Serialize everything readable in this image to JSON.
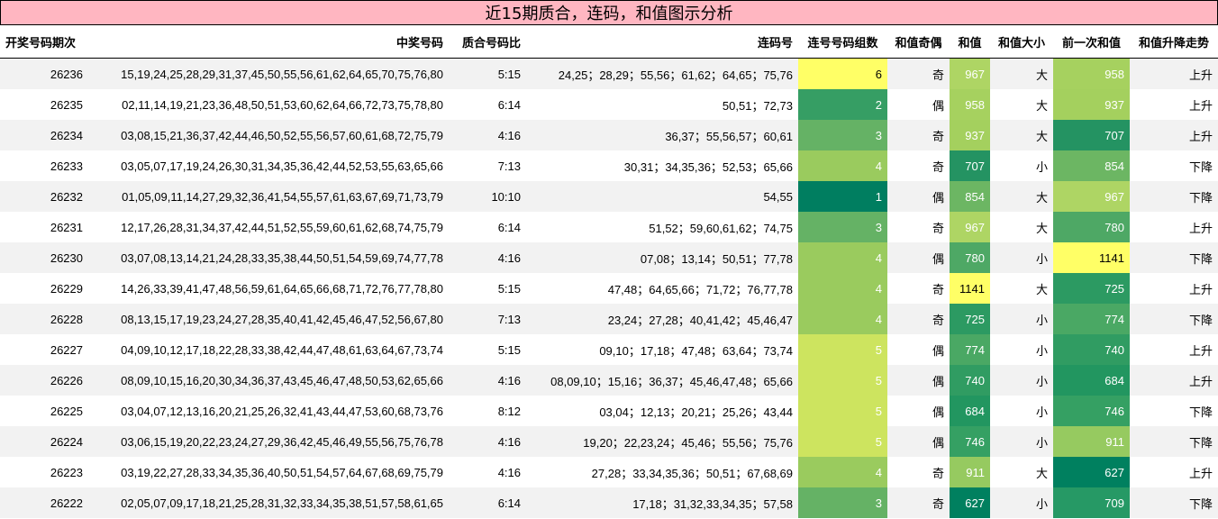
{
  "title": "近15期质合，连码，和值图示分析",
  "headers": [
    "开奖号码期次",
    "中奖号码",
    "质合号码比",
    "连码号",
    "连号号码组数",
    "和值奇偶",
    "和值",
    "和值大小",
    "前一次和值",
    "和值升降走势"
  ],
  "colors": {
    "title_bg": "#ffb6c1",
    "row_odd": "#f2f2f2",
    "row_even": "#ffffff",
    "heat": {
      "1": "#007e60",
      "2": "#369e64",
      "3": "#65b265",
      "4": "#9acb5e",
      "5": "#cde45f",
      "6": "#ffff66",
      "627": "#00805f",
      "684": "#229660",
      "707": "#249362",
      "709": "#269965",
      "725": "#2c9a62",
      "740": "#309c62",
      "746": "#35a063",
      "774": "#4aa864",
      "780": "#4ea865",
      "854": "#6cb663",
      "911": "#96ca60",
      "937": "#a4d05e",
      "958": "#a6d15f",
      "967": "#aed564",
      "1141": "#ffff66"
    }
  },
  "rows": [
    {
      "period": "26236",
      "numbers": "15,19,24,25,28,29,31,37,45,50,55,56,61,62,64,65,70,75,76,80",
      "ratio": "5:15",
      "consec": "24,25；28,29；55,56；61,62；64,65；75,76",
      "groups": "6",
      "parity": "奇",
      "sum": "967",
      "size": "大",
      "prev_sum": "958",
      "trend": "上升"
    },
    {
      "period": "26235",
      "numbers": "02,11,14,19,21,23,36,48,50,51,53,60,62,64,66,72,73,75,78,80",
      "ratio": "6:14",
      "consec": "50,51；72,73",
      "groups": "2",
      "parity": "偶",
      "sum": "958",
      "size": "大",
      "prev_sum": "937",
      "trend": "上升"
    },
    {
      "period": "26234",
      "numbers": "03,08,15,21,36,37,42,44,46,50,52,55,56,57,60,61,68,72,75,79",
      "ratio": "4:16",
      "consec": "36,37；55,56,57；60,61",
      "groups": "3",
      "parity": "奇",
      "sum": "937",
      "size": "大",
      "prev_sum": "707",
      "trend": "上升"
    },
    {
      "period": "26233",
      "numbers": "03,05,07,17,19,24,26,30,31,34,35,36,42,44,52,53,55,63,65,66",
      "ratio": "7:13",
      "consec": "30,31；34,35,36；52,53；65,66",
      "groups": "4",
      "parity": "奇",
      "sum": "707",
      "size": "小",
      "prev_sum": "854",
      "trend": "下降"
    },
    {
      "period": "26232",
      "numbers": "01,05,09,11,14,27,29,32,36,41,54,55,57,61,63,67,69,71,73,79",
      "ratio": "10:10",
      "consec": "54,55",
      "groups": "1",
      "parity": "偶",
      "sum": "854",
      "size": "大",
      "prev_sum": "967",
      "trend": "下降"
    },
    {
      "period": "26231",
      "numbers": "12,17,26,28,31,34,37,42,44,51,52,55,59,60,61,62,68,74,75,79",
      "ratio": "6:14",
      "consec": "51,52；59,60,61,62；74,75",
      "groups": "3",
      "parity": "奇",
      "sum": "967",
      "size": "大",
      "prev_sum": "780",
      "trend": "上升"
    },
    {
      "period": "26230",
      "numbers": "03,07,08,13,14,21,24,28,33,35,38,44,50,51,54,59,69,74,77,78",
      "ratio": "4:16",
      "consec": "07,08；13,14；50,51；77,78",
      "groups": "4",
      "parity": "偶",
      "sum": "780",
      "size": "小",
      "prev_sum": "1141",
      "trend": "下降"
    },
    {
      "period": "26229",
      "numbers": "14,26,33,39,41,47,48,56,59,61,64,65,66,68,71,72,76,77,78,80",
      "ratio": "5:15",
      "consec": "47,48；64,65,66；71,72；76,77,78",
      "groups": "4",
      "parity": "奇",
      "sum": "1141",
      "size": "大",
      "prev_sum": "725",
      "trend": "上升"
    },
    {
      "period": "26228",
      "numbers": "08,13,15,17,19,23,24,27,28,35,40,41,42,45,46,47,52,56,67,80",
      "ratio": "7:13",
      "consec": "23,24；27,28；40,41,42；45,46,47",
      "groups": "4",
      "parity": "奇",
      "sum": "725",
      "size": "小",
      "prev_sum": "774",
      "trend": "下降"
    },
    {
      "period": "26227",
      "numbers": "04,09,10,12,17,18,22,28,33,38,42,44,47,48,61,63,64,67,73,74",
      "ratio": "5:15",
      "consec": "09,10；17,18；47,48；63,64；73,74",
      "groups": "5",
      "parity": "偶",
      "sum": "774",
      "size": "小",
      "prev_sum": "740",
      "trend": "上升"
    },
    {
      "period": "26226",
      "numbers": "08,09,10,15,16,20,30,34,36,37,43,45,46,47,48,50,53,62,65,66",
      "ratio": "4:16",
      "consec": "08,09,10；15,16；36,37；45,46,47,48；65,66",
      "groups": "5",
      "parity": "偶",
      "sum": "740",
      "size": "小",
      "prev_sum": "684",
      "trend": "上升"
    },
    {
      "period": "26225",
      "numbers": "03,04,07,12,13,16,20,21,25,26,32,41,43,44,47,53,60,68,73,76",
      "ratio": "8:12",
      "consec": "03,04；12,13；20,21；25,26；43,44",
      "groups": "5",
      "parity": "偶",
      "sum": "684",
      "size": "小",
      "prev_sum": "746",
      "trend": "下降"
    },
    {
      "period": "26224",
      "numbers": "03,06,15,19,20,22,23,24,27,29,36,42,45,46,49,55,56,75,76,78",
      "ratio": "4:16",
      "consec": "19,20；22,23,24；45,46；55,56；75,76",
      "groups": "5",
      "parity": "偶",
      "sum": "746",
      "size": "小",
      "prev_sum": "911",
      "trend": "下降"
    },
    {
      "period": "26223",
      "numbers": "03,19,22,27,28,33,34,35,36,40,50,51,54,57,64,67,68,69,75,79",
      "ratio": "4:16",
      "consec": "27,28；33,34,35,36；50,51；67,68,69",
      "groups": "4",
      "parity": "奇",
      "sum": "911",
      "size": "大",
      "prev_sum": "627",
      "trend": "上升"
    },
    {
      "period": "26222",
      "numbers": "02,05,07,09,17,18,21,25,28,31,32,33,34,35,38,51,57,58,61,65",
      "ratio": "6:14",
      "consec": "17,18；31,32,33,34,35；57,58",
      "groups": "3",
      "parity": "奇",
      "sum": "627",
      "size": "小",
      "prev_sum": "709",
      "trend": "下降"
    }
  ]
}
